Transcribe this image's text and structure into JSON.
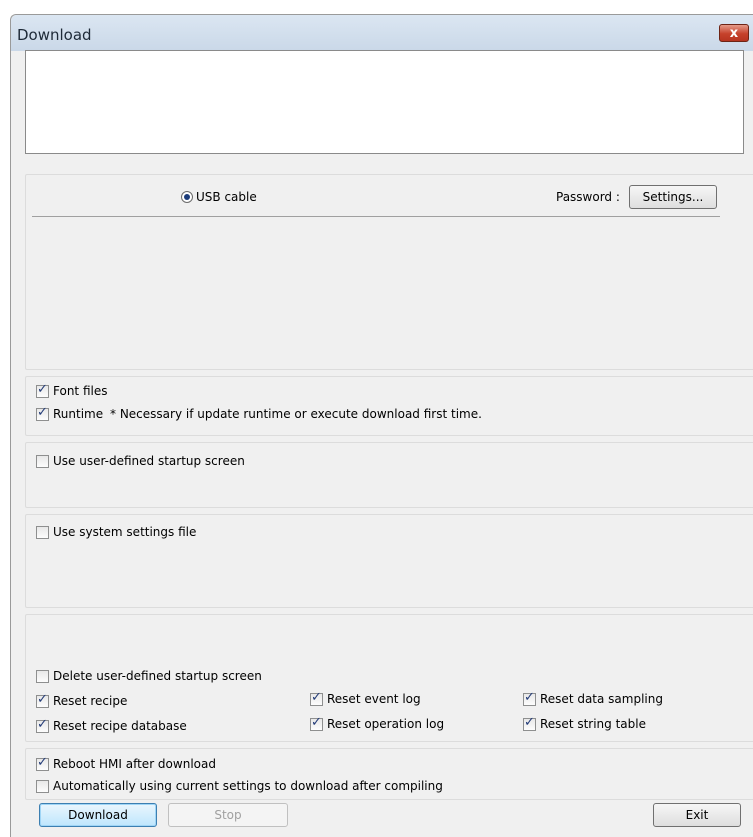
{
  "window": {
    "title": "Download",
    "close_symbol": "x"
  },
  "connection": {
    "usb_label": "USB cable",
    "usb_selected": true,
    "password_label": "Password :",
    "settings_button": "Settings..."
  },
  "files": {
    "font_files": {
      "label": "Font files",
      "checked": true
    },
    "runtime": {
      "label": "Runtime",
      "checked": true
    },
    "runtime_note": "* Necessary if update runtime or execute download first time."
  },
  "startup": {
    "label": "Use user-defined startup screen",
    "checked": false
  },
  "system_settings": {
    "label": "Use system settings file",
    "checked": false
  },
  "reset_options": {
    "delete_startup": {
      "label": "Delete user-defined startup screen",
      "checked": false
    },
    "reset_recipe": {
      "label": "Reset recipe",
      "checked": true
    },
    "reset_recipe_db": {
      "label": "Reset recipe database",
      "checked": true
    },
    "reset_event_log": {
      "label": "Reset event log",
      "checked": true
    },
    "reset_operation_log": {
      "label": "Reset operation log",
      "checked": true
    },
    "reset_data_sampling": {
      "label": "Reset data sampling",
      "checked": true
    },
    "reset_string_table": {
      "label": "Reset string table",
      "checked": true
    }
  },
  "post": {
    "reboot": {
      "label": "Reboot HMI after download",
      "checked": true
    },
    "auto": {
      "label": "Automatically using current settings to download after compiling",
      "checked": false
    }
  },
  "buttons": {
    "download": "Download",
    "stop": "Stop",
    "exit": "Exit"
  }
}
